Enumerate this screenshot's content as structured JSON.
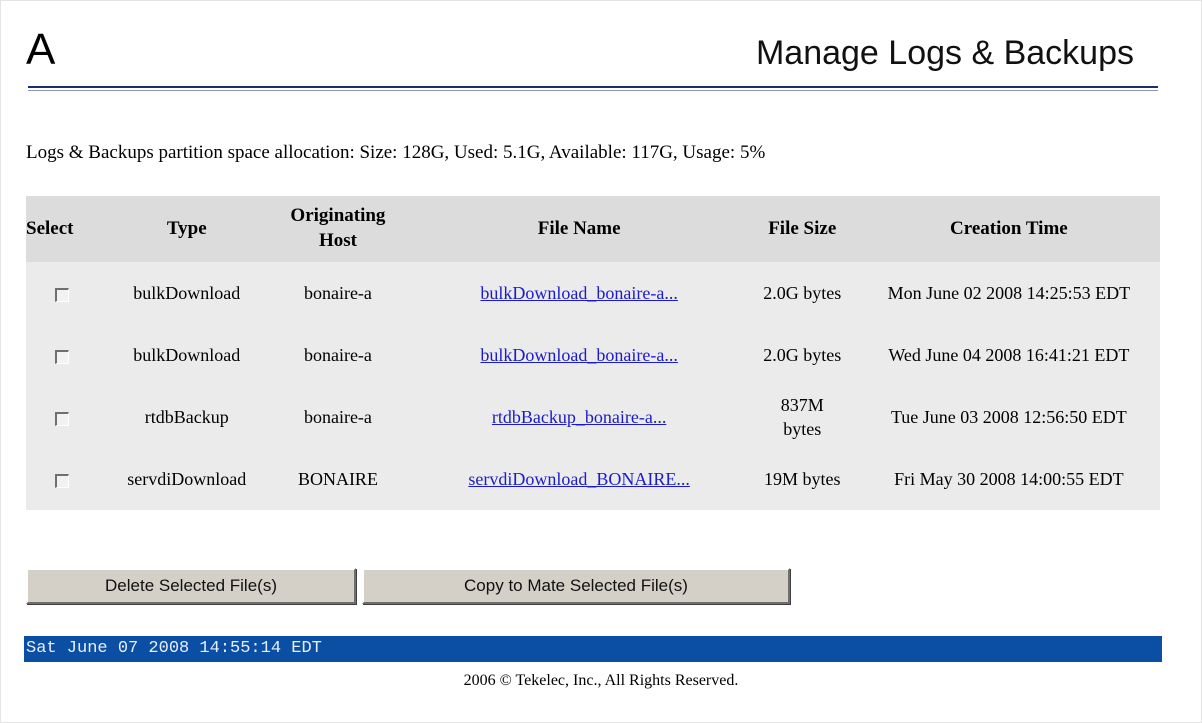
{
  "header": {
    "logo_text": "A",
    "title": "Manage Logs & Backups"
  },
  "space_info": "Logs & Backups partition space allocation: Size: 128G, Used: 5.1G, Available: 117G, Usage: 5%",
  "table": {
    "columns": [
      "Select",
      "Type",
      "Originating Host",
      "File Name",
      "File Size",
      "Creation Time"
    ],
    "rows": [
      {
        "checked": false,
        "type": "bulkDownload",
        "host": "bonaire-a",
        "file_name": "bulkDownload_bonaire-a...",
        "file_size": "2.0G bytes",
        "creation_time": "Mon June 02 2008 14:25:53 EDT"
      },
      {
        "checked": false,
        "type": "bulkDownload",
        "host": "bonaire-a",
        "file_name": "bulkDownload_bonaire-a...",
        "file_size": "2.0G bytes",
        "creation_time": "Wed June 04 2008 16:41:21 EDT"
      },
      {
        "checked": false,
        "type": "rtdbBackup",
        "host": "bonaire-a",
        "file_name": "rtdbBackup_bonaire-a...",
        "file_size": "837M bytes",
        "creation_time": "Tue June 03 2008 12:56:50 EDT"
      },
      {
        "checked": false,
        "type": "servdiDownload",
        "host": "BONAIRE",
        "file_name": "servdiDownload_BONAIRE...",
        "file_size": "19M bytes",
        "creation_time": "Fri May 30 2008 14:00:55 EDT"
      }
    ]
  },
  "buttons": {
    "delete_label": "Delete Selected File(s)",
    "copy_label": "Copy to Mate Selected File(s)"
  },
  "status_bar": {
    "datetime": "Sat June 07 2008 14:55:14 EDT"
  },
  "footer": {
    "copyright": "2006 © Tekelec, Inc., All Rights Reserved."
  },
  "colors": {
    "status_bar_bg": "#0a4fa3",
    "link": "#1b1bcc",
    "title_rule": "#1c2f6b"
  }
}
